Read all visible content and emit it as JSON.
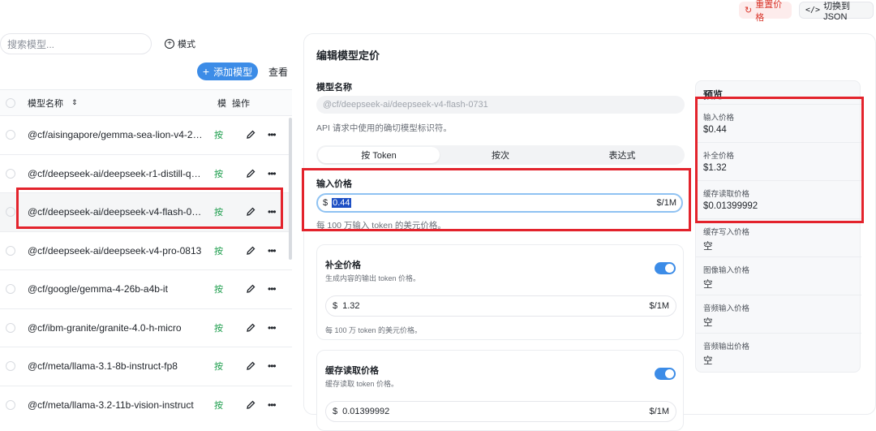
{
  "topbar": {
    "reset_label": "重置价格",
    "json_label": "切换到 JSON"
  },
  "sidebar": {
    "search_placeholder": "搜索模型...",
    "mode_label": "模式",
    "add_label": "添加模型",
    "view_label": "查看",
    "table": {
      "col_name": "模型名称",
      "col_mode": "模",
      "col_ops": "操作",
      "rows": [
        {
          "name": "@cf/aisingapore/gemma-sea-lion-v4-27…",
          "mode": "按"
        },
        {
          "name": "@cf/deepseek-ai/deepseek-r1-distill-qw…",
          "mode": "按"
        },
        {
          "name": "@cf/deepseek-ai/deepseek-v4-flash-0731",
          "mode": "按"
        },
        {
          "name": "@cf/deepseek-ai/deepseek-v4-pro-0813",
          "mode": "按"
        },
        {
          "name": "@cf/google/gemma-4-26b-a4b-it",
          "mode": "按"
        },
        {
          "name": "@cf/ibm-granite/granite-4.0-h-micro",
          "mode": "按"
        },
        {
          "name": "@cf/meta/llama-3.1-8b-instruct-fp8",
          "mode": "按"
        },
        {
          "name": "@cf/meta/llama-3.2-11b-vision-instruct",
          "mode": "按"
        }
      ]
    }
  },
  "editor": {
    "title": "编辑模型定价",
    "model_name_label": "模型名称",
    "model_name_value": "@cf/deepseek-ai/deepseek-v4-flash-0731",
    "model_name_hint": "API 请求中使用的确切模型标识符。",
    "tabs": [
      "按 Token",
      "按次",
      "表达式"
    ],
    "input_price": {
      "label": "输入价格",
      "currency": "$",
      "value": "0.44",
      "unit": "$/1M",
      "hint": "每 100 万输入 token 的美元价格。"
    },
    "completion": {
      "title": "补全价格",
      "subtitle": "生成内容的输出 token 价格。",
      "currency": "$",
      "value": "1.32",
      "unit": "$/1M",
      "hint": "每 100 万 token 的美元价格。"
    },
    "cache_read": {
      "title": "缓存读取价格",
      "subtitle": "缓存读取 token 价格。",
      "currency": "$",
      "value": "0.01399992",
      "unit": "$/1M"
    }
  },
  "preview": {
    "title": "预览",
    "items": [
      {
        "label": "输入价格",
        "value": "$0.44"
      },
      {
        "label": "补全价格",
        "value": "$1.32"
      },
      {
        "label": "缓存读取价格",
        "value": "$0.01399992"
      },
      {
        "label": "缓存写入价格",
        "value": "空"
      },
      {
        "label": "图像输入价格",
        "value": "空"
      },
      {
        "label": "音频输入价格",
        "value": "空"
      },
      {
        "label": "音频输出价格",
        "value": "空"
      }
    ]
  },
  "colors": {
    "accent": "#3c8ce7",
    "highlight_box": "#e3232c",
    "mode_green": "#1a9c4a"
  }
}
